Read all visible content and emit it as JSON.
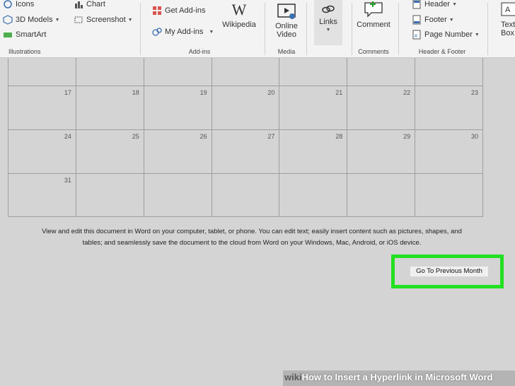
{
  "ribbon": {
    "illustrations": {
      "icons": "Icons",
      "models_3d": "3D Models",
      "smartart": "SmartArt",
      "chart": "Chart",
      "screenshot": "Screenshot",
      "label": "Illustrations"
    },
    "addins": {
      "get_addins": "Get Add-ins",
      "my_addins": "My Add-ins",
      "wikipedia": "Wikipedia",
      "label": "Add-ins"
    },
    "media": {
      "online_video_line1": "Online",
      "online_video_line2": "Video",
      "label": "Media"
    },
    "links": {
      "links": "Links"
    },
    "comments": {
      "comment": "Comment",
      "label": "Comments"
    },
    "header_footer": {
      "header": "Header",
      "footer": "Footer",
      "page_number": "Page Number",
      "label": "Header & Footer"
    },
    "text": {
      "text_box_line1": "Text",
      "text_box_line2": "Box"
    }
  },
  "calendar": {
    "rows": [
      [
        "",
        "",
        "",
        "",
        "",
        "",
        ""
      ],
      [
        "17",
        "18",
        "19",
        "20",
        "21",
        "22",
        "23"
      ],
      [
        "24",
        "25",
        "26",
        "27",
        "28",
        "29",
        "30"
      ],
      [
        "31",
        "",
        "",
        "",
        "",
        "",
        ""
      ]
    ]
  },
  "note_line1": "View and edit this document in Word on your computer, tablet, or phone. You can edit text; easily insert content such as pictures, shapes, and",
  "note_line2": "tables; and seamlessly save the document to the cloud from Word on your Windows, Mac, Android, or iOS device.",
  "button_label": "Go To Previous Month",
  "watermark": {
    "wiki": "wiki",
    "rest": "How to Insert a Hyperlink in Microsoft Word"
  },
  "colors": {
    "highlight": "#22e022"
  }
}
